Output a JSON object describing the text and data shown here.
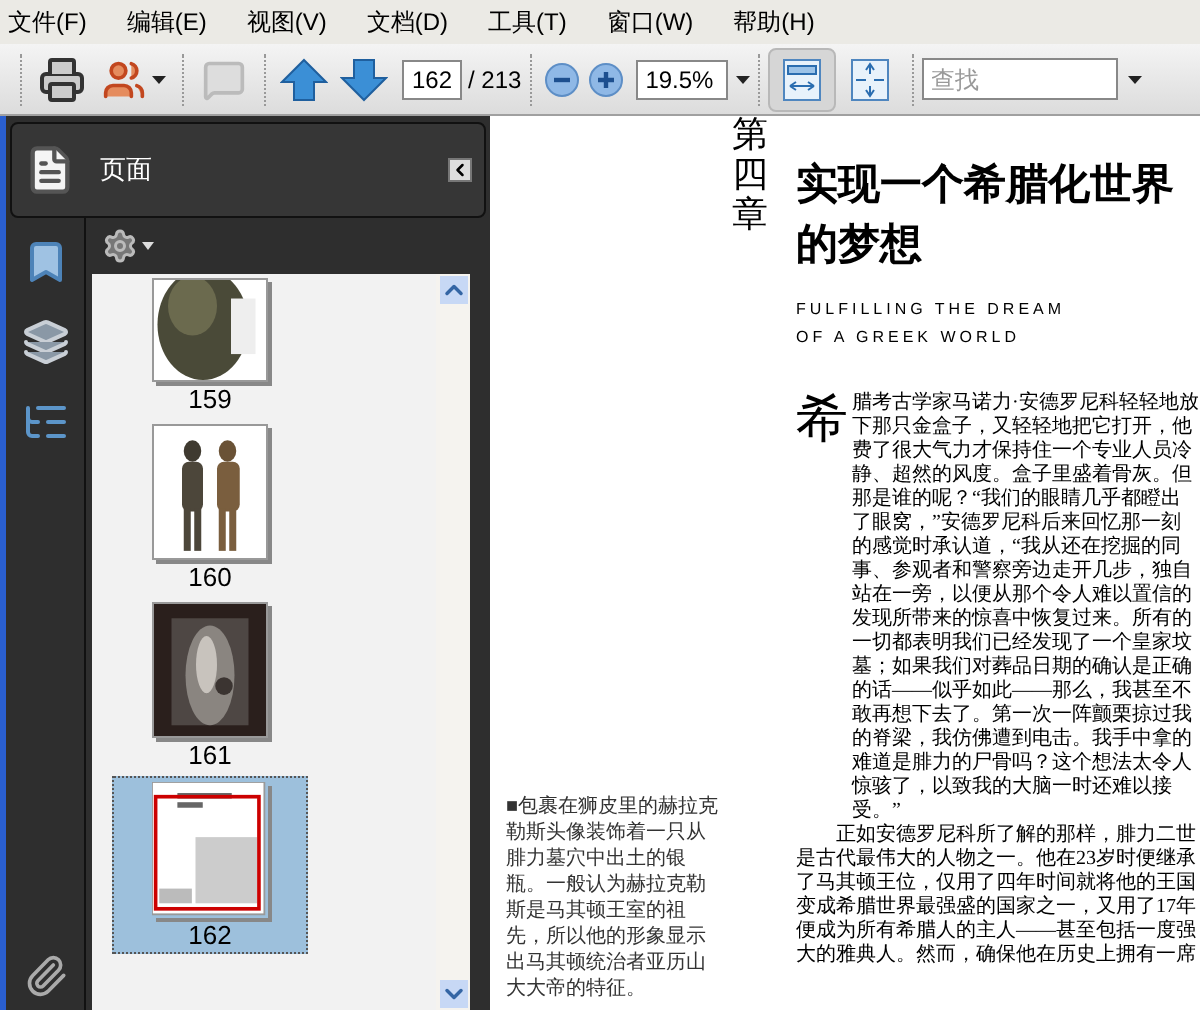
{
  "menu": [
    "文件(F)",
    "编辑(E)",
    "视图(V)",
    "文档(D)",
    "工具(T)",
    "窗口(W)",
    "帮助(H)"
  ],
  "toolbar": {
    "review_disabled": true,
    "page_number": "162",
    "page_total": "/ 213",
    "zoom": "19.5%",
    "view_buttons": [
      {
        "kind": "fit-width",
        "selected": true
      },
      {
        "kind": "fit-page",
        "selected": false
      }
    ],
    "search": {
      "placeholder": "查找"
    }
  },
  "panel": {
    "title": "页面",
    "thumbnails": [
      {
        "label": "159",
        "kind": "picture",
        "selected": false
      },
      {
        "label": "160",
        "kind": "picture",
        "selected": false
      },
      {
        "label": "161",
        "kind": "picture",
        "selected": false
      },
      {
        "label": "162",
        "kind": "page",
        "selected": true
      }
    ]
  },
  "document": {
    "chapter": "第四章",
    "title": "实现一个希腊化世界的梦想",
    "subtitle": [
      "FULFILLING THE DREAM",
      "OF A GREEK WORLD"
    ],
    "drop_cap": "希",
    "paragraphs": [
      "腊考古学家马诺力·安德罗尼科轻轻地放下那只金盒子，又轻轻地把它打开，他费了很大气力才保持住一个专业人员冷静、超然的风度。盒子里盛着骨灰。但那是谁的呢？“我们的眼睛几乎都瞪出了眼窝，”安德罗尼科后来回忆那一刻的感觉时承认道，“我从还在挖掘的同事、参观者和警察旁边走开几步，独自站在一旁，以便从那个令人难以置信的发现所带来的惊喜中恢复过来。所有的一切都表明我们已经发现了一个皇家坟墓；如果我们对葬品日期的确认是正确的话——似乎如此——那么，我甚至不敢再想下去了。第一次一阵颤栗掠过我的脊梁，我仿佛遭到电击。我手中拿的难道是腓力的尸骨吗？这个想法太令人惊骇了，以致我的大脑一时还难以接受。”",
      "正如安德罗尼科所了解的那样，腓力二世是古代最伟大的人物之一。他在23岁时便继承了马其顿王位，仅用了四年时间就将他的王国变成希腊世界最强盛的国家之一，又用了17年便成为所有希腊人的主人——甚至包括一度强大的雅典人。然而，确保他在历史上拥有一席"
    ],
    "caption": "■包裹在狮皮里的赫拉克勒斯头像装饰着一只从腓力墓穴中出土的银瓶。一般认为赫拉克勒斯是马其顿王室的祖先，所以他的形象显示出马其顿统治者亚历山大大帝的特征。"
  }
}
